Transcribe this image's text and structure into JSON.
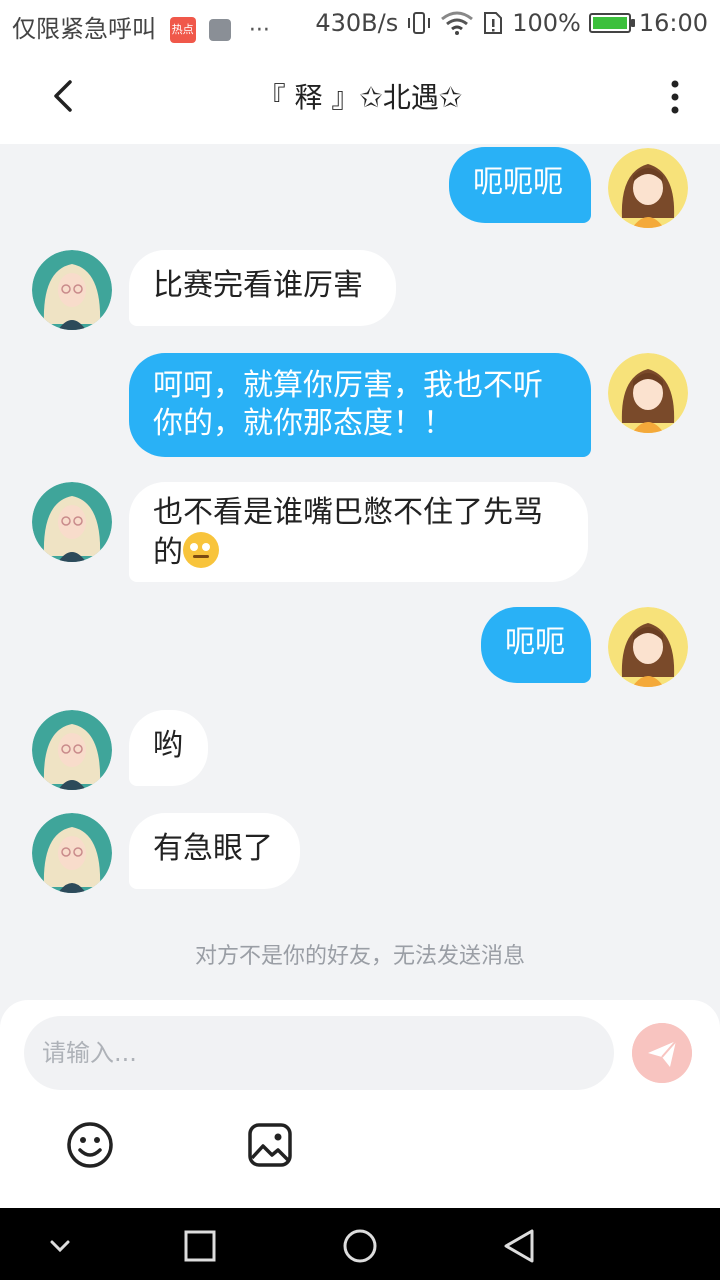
{
  "status_bar": {
    "left_text": "仅限紧急呼叫",
    "hot_badge": "热点",
    "speed": "430B/s",
    "battery": "100%",
    "time": "16:00"
  },
  "header": {
    "title": "『 释 』✩北遇✩"
  },
  "messages": [
    {
      "from": "me",
      "text": "呃呃呃"
    },
    {
      "from": "them",
      "text": "比赛完看谁厉害"
    },
    {
      "from": "me",
      "text": "呵呵，就算你厉害，我也不听你的，就你那态度！！"
    },
    {
      "from": "them",
      "text": "也不看是谁嘴巴憋不住了先骂的",
      "emoji": "rolling-eyes"
    },
    {
      "from": "me",
      "text": "呃呃"
    },
    {
      "from": "them",
      "text": "哟"
    },
    {
      "from": "them",
      "text": "有急眼了"
    }
  ],
  "notice": "对方不是你的好友，无法发送消息",
  "composer": {
    "placeholder": "请输入...",
    "value": ""
  },
  "icons": {
    "back": "chevron-left-icon",
    "more": "more-vertical-icon",
    "send": "send-icon",
    "emoji": "emoji-icon",
    "image": "image-icon",
    "nav_down": "chevron-down-icon",
    "nav_home": "circle-home-icon",
    "nav_recents": "square-recents-icon",
    "nav_back": "triangle-back-icon"
  },
  "colors": {
    "mine_bubble": "#29b1f6",
    "theirs_bubble": "#ffffff",
    "background": "#f2f3f5",
    "send_button": "#f8c4c0"
  }
}
